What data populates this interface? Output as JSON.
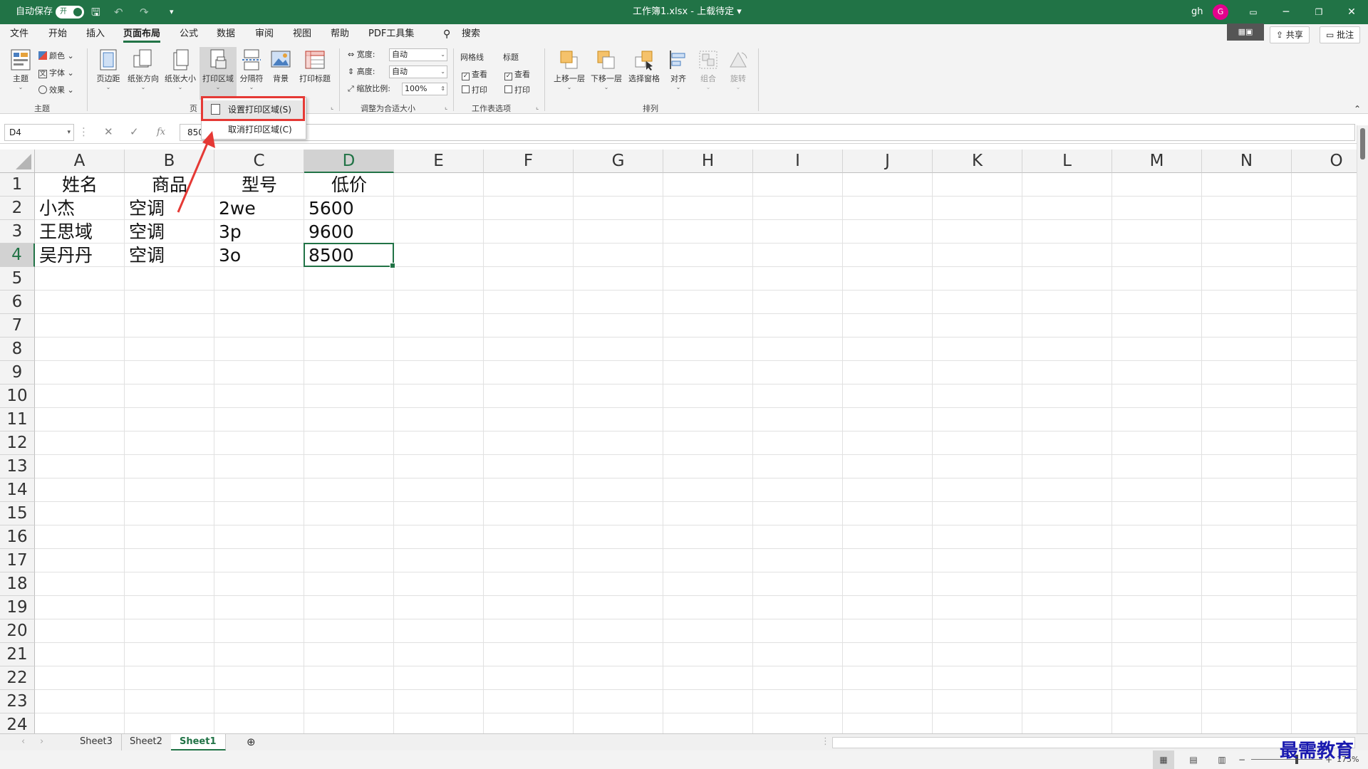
{
  "titlebar": {
    "autosave_label": "自动保存",
    "autosave_state": "开",
    "filename": "工作簿1.xlsx - 上载待定 ▾",
    "user": "gh",
    "avatar": "G"
  },
  "menu": {
    "tabs": [
      "文件",
      "开始",
      "插入",
      "页面布局",
      "公式",
      "数据",
      "审阅",
      "视图",
      "帮助",
      "PDF工具集"
    ],
    "active_tab": "页面布局",
    "search_label": "搜索",
    "share_label": "共享",
    "comment_label": "批注"
  },
  "ribbon": {
    "themes_group": {
      "label": "主题",
      "theme_btn": "主题",
      "colors_btn": "颜色",
      "fonts_btn": "字体",
      "effects_btn": "效果"
    },
    "page_setup_group": {
      "label": "页",
      "margins_btn": "页边距",
      "orientation_btn": "纸张方向",
      "size_btn": "纸张大小",
      "print_area_btn": "打印区域",
      "breaks_btn": "分隔符",
      "background_btn": "背景",
      "print_titles_btn": "打印标题"
    },
    "scale_group": {
      "label": "调整为合适大小",
      "width_label": "宽度:",
      "width_value": "自动",
      "height_label": "高度:",
      "height_value": "自动",
      "scale_label": "缩放比例:",
      "scale_value": "100%"
    },
    "sheet_options_group": {
      "label": "工作表选项",
      "gridlines_label": "网格线",
      "headings_label": "标题",
      "view_label": "查看",
      "print_label": "打印",
      "check_mark": "✓"
    },
    "arrange_group": {
      "label": "排列",
      "bring_forward_btn": "上移一层",
      "send_backward_btn": "下移一层",
      "selection_pane_btn": "选择窗格",
      "align_btn": "对齐",
      "group_btn": "组合",
      "rotate_btn": "旋转"
    }
  },
  "dropdown": {
    "items": [
      "设置打印区域(S)",
      "取消打印区域(C)"
    ]
  },
  "formula_bar": {
    "name_box": "D4",
    "cancel_icon": "✕",
    "enter_icon": "✓",
    "fx_label": "fx",
    "value": "8500"
  },
  "grid": {
    "columns": [
      "A",
      "B",
      "C",
      "D",
      "E",
      "F",
      "G",
      "H",
      "I",
      "J",
      "K",
      "L",
      "M",
      "N",
      "O"
    ],
    "selected_column": "D",
    "rows": [
      "1",
      "2",
      "3",
      "4",
      "5",
      "6",
      "7",
      "8",
      "9",
      "10",
      "11",
      "12",
      "13",
      "14",
      "15",
      "16",
      "17",
      "18",
      "19",
      "20",
      "21",
      "22",
      "23",
      "24"
    ],
    "selected_row": "4",
    "header_row": [
      "姓名",
      "商品",
      "型号",
      "低价"
    ],
    "data_rows": [
      [
        "小杰",
        "空调",
        "2we",
        "5600"
      ],
      [
        "王思域",
        "空调",
        "3p",
        "9600"
      ],
      [
        "吴丹丹",
        "空调",
        "3o",
        "8500"
      ]
    ]
  },
  "sheets": {
    "tabs": [
      "Sheet3",
      "Sheet2",
      "Sheet1"
    ],
    "active": "Sheet1",
    "add_icon": "⊕"
  },
  "statusbar": {
    "zoom": "175%"
  },
  "watermark": "最需教育",
  "colors": {
    "accent": "#217346",
    "highlight_box": "#e53935"
  }
}
